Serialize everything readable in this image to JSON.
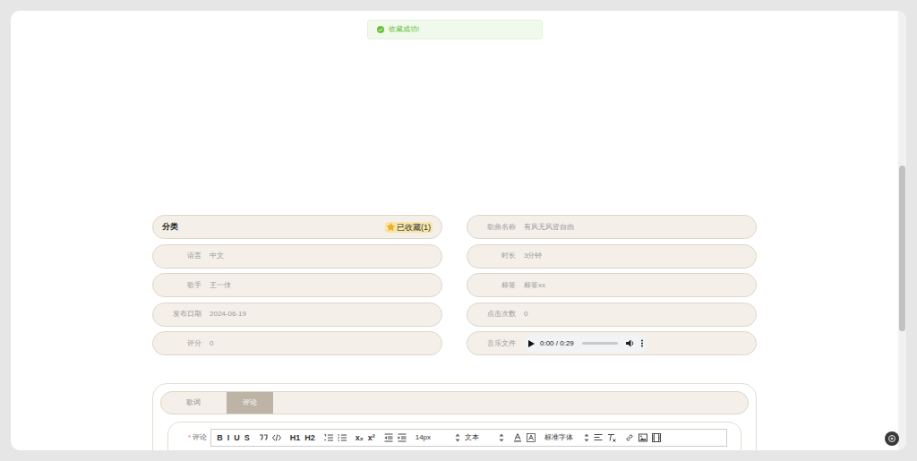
{
  "toast": {
    "text": "收藏成功!",
    "kind": "success"
  },
  "category": {
    "label": "分类",
    "badge": "已收藏(1)",
    "favorited": true
  },
  "fields_left": [
    {
      "label": "语言",
      "value": "中文"
    },
    {
      "label": "歌手",
      "value": "王一佳"
    },
    {
      "label": "发布日期",
      "value": "2024-06-19"
    },
    {
      "label": "评分",
      "value": "0"
    }
  ],
  "fields_right": [
    {
      "label": "歌曲名称",
      "value": "有风无风皆自由"
    },
    {
      "label": "时长",
      "value": "3分钟"
    },
    {
      "label": "标签",
      "value": "标签xx"
    },
    {
      "label": "点击次数",
      "value": "0"
    }
  ],
  "audio": {
    "label": "音乐文件",
    "time": "0:00 / 0:29",
    "level": 0,
    "playing": false
  },
  "tabs": [
    {
      "label": "歌词",
      "selected": false
    },
    {
      "label": "评论",
      "selected": true
    }
  ],
  "editor": {
    "required_mark": "*",
    "label": "评论",
    "toolbar": [
      {
        "kind": "text",
        "label": "B"
      },
      {
        "kind": "text",
        "label": "I"
      },
      {
        "kind": "text",
        "label": "U"
      },
      {
        "kind": "text",
        "label": "S"
      },
      {
        "kind": "quote"
      },
      {
        "kind": "code"
      },
      {
        "kind": "text",
        "label": "H1"
      },
      {
        "kind": "text",
        "label": "H2"
      },
      {
        "kind": "ordered"
      },
      {
        "kind": "bullet"
      },
      {
        "kind": "text",
        "label": "x₂"
      },
      {
        "kind": "text",
        "label": "x²"
      },
      {
        "kind": "outdent"
      },
      {
        "kind": "indent"
      },
      {
        "kind": "select",
        "label": "14px"
      },
      {
        "kind": "select",
        "label": "文本"
      },
      {
        "kind": "color"
      },
      {
        "kind": "background"
      },
      {
        "kind": "select",
        "label": "标准字体"
      },
      {
        "kind": "align"
      },
      {
        "kind": "clean"
      },
      {
        "kind": "link"
      },
      {
        "kind": "image"
      },
      {
        "kind": "video"
      }
    ]
  }
}
